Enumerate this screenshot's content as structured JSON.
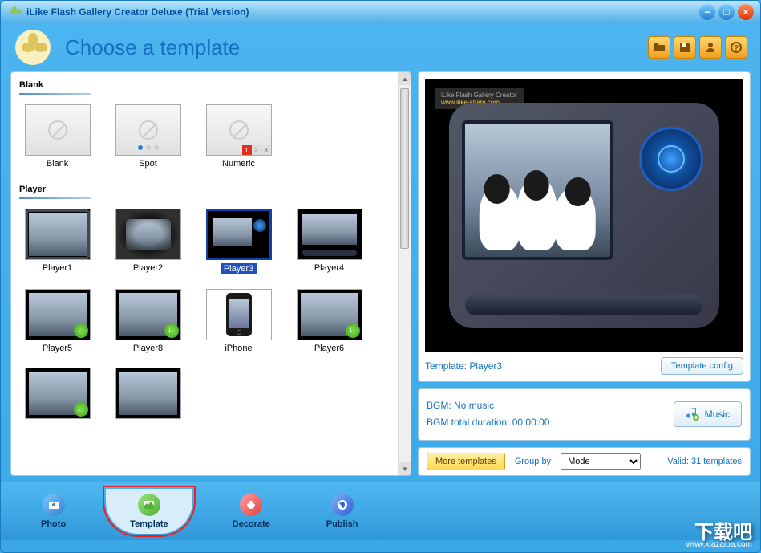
{
  "title": "iLike Flash Gallery Creator Deluxe (Trial Version)",
  "header": {
    "title": "Choose a template"
  },
  "sections": {
    "blank": {
      "title": "Blank",
      "items": [
        {
          "label": "Blank"
        },
        {
          "label": "Spot"
        },
        {
          "label": "Numeric"
        }
      ]
    },
    "player": {
      "title": "Player",
      "items": [
        {
          "label": "Player1"
        },
        {
          "label": "Player2"
        },
        {
          "label": "Player3",
          "selected": true
        },
        {
          "label": "Player4"
        },
        {
          "label": "Player5"
        },
        {
          "label": "Player8"
        },
        {
          "label": "iPhone"
        },
        {
          "label": "Player6"
        }
      ]
    }
  },
  "preview": {
    "label_prefix": "Template: ",
    "template_name": "Player3",
    "config_button": "Template config",
    "watermark_title": "iLike Flash Gallery Creator",
    "watermark_link": "www.ilike-share.com"
  },
  "bgm": {
    "line1_prefix": "BGM: ",
    "line1_value": "No music",
    "line2_prefix": "BGM total duration: ",
    "line2_value": "00:00:00",
    "music_button": "Music"
  },
  "bottom": {
    "more_templates": "More templates",
    "group_by_label": "Group by",
    "group_by_value": "Mode",
    "valid_label": "Valid: 31 templates"
  },
  "footer_tabs": [
    {
      "label": "Photo",
      "icon": "photo"
    },
    {
      "label": "Template",
      "icon": "template",
      "active": true,
      "highlighted": true
    },
    {
      "label": "Decorate",
      "icon": "decorate"
    },
    {
      "label": "Publish",
      "icon": "publish"
    }
  ],
  "watermark": {
    "main": "下载吧",
    "sub": "www.xiazaiba.com"
  }
}
